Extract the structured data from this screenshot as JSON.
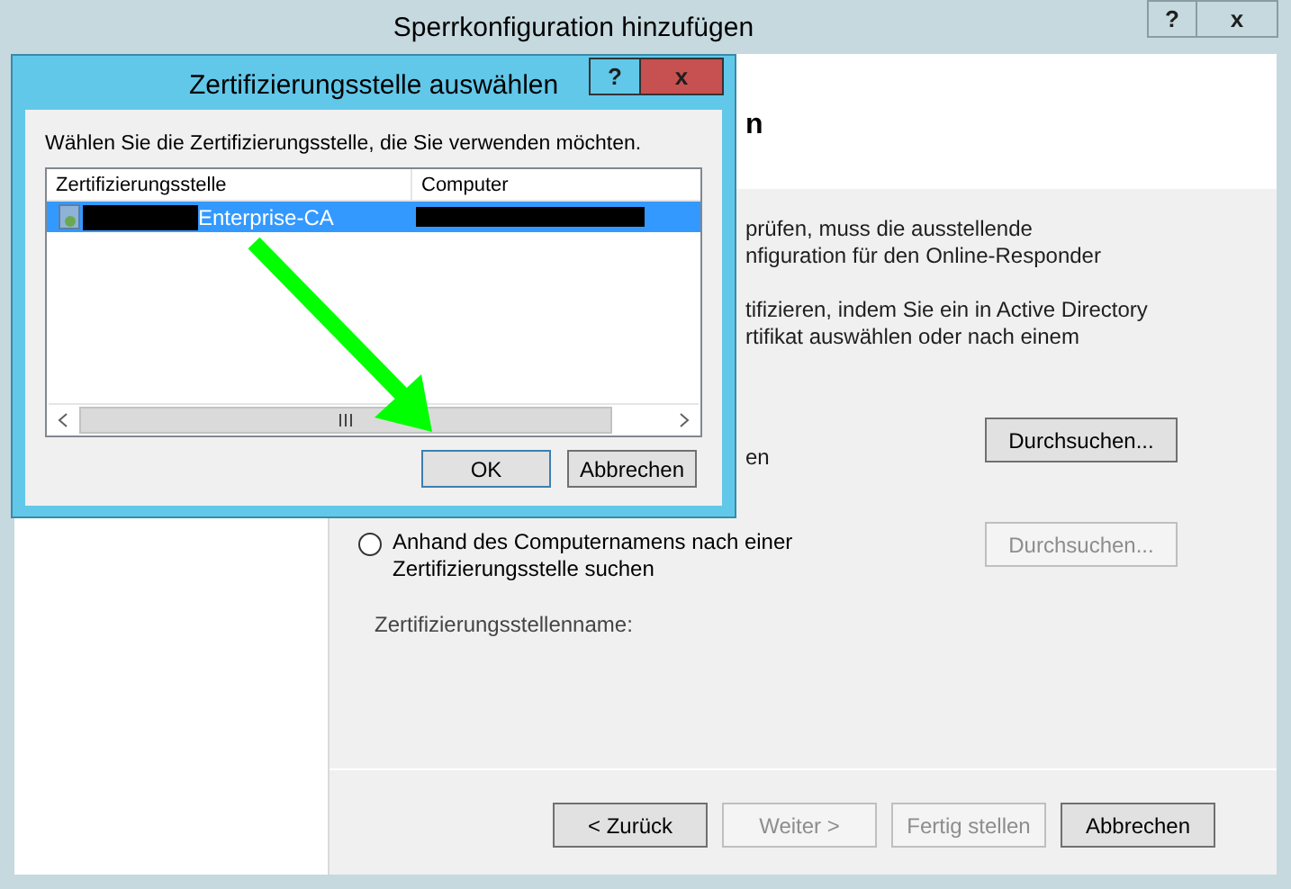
{
  "window": {
    "title": "Sperrkonfiguration hinzufügen",
    "help": "?",
    "close": "x"
  },
  "page": {
    "heading_fragment": "n",
    "description_fragments": [
      "prüfen, muss die ausstellende",
      "nfiguration für den Online-Responder"
    ],
    "instruction_fragments": [
      "tifizieren, indem Sie ein in Active Directory",
      "rtifikat auswählen oder nach einem"
    ],
    "option_1": {
      "label_fragment": "en",
      "button": {
        "label": "Durchsuchen...",
        "disabled": false
      }
    },
    "option_2": {
      "label": "Anhand des Computernamens nach einer Zertifizierungsstelle suchen",
      "selected": false,
      "button": {
        "label": "Durchsuchen...",
        "disabled": true
      }
    },
    "ca_name_label": "Zertifizierungsstellenname:"
  },
  "buttons": [
    {
      "label": "< Zurück",
      "disabled": false
    },
    {
      "label": "Weiter >",
      "disabled": true
    },
    {
      "label": "Fertig stellen",
      "disabled": true
    },
    {
      "label": "Abbrechen",
      "disabled": false
    }
  ],
  "dialog": {
    "title": "Zertifizierungsstelle auswählen",
    "help": "?",
    "close": "x",
    "prompt": "Wählen Sie die Zertifizierungsstelle, die Sie verwenden möchten.",
    "columns": [
      "Zertifizierungsstelle",
      "Computer"
    ],
    "rows": [
      {
        "selected": true,
        "ca": {
          "redacted_prefix": true,
          "text": "Enterprise-CA"
        },
        "computer": {
          "redacted": true
        }
      }
    ],
    "buttons": [
      {
        "label": "OK",
        "default": true
      },
      {
        "label": "Abbrechen",
        "default": false
      }
    ]
  }
}
